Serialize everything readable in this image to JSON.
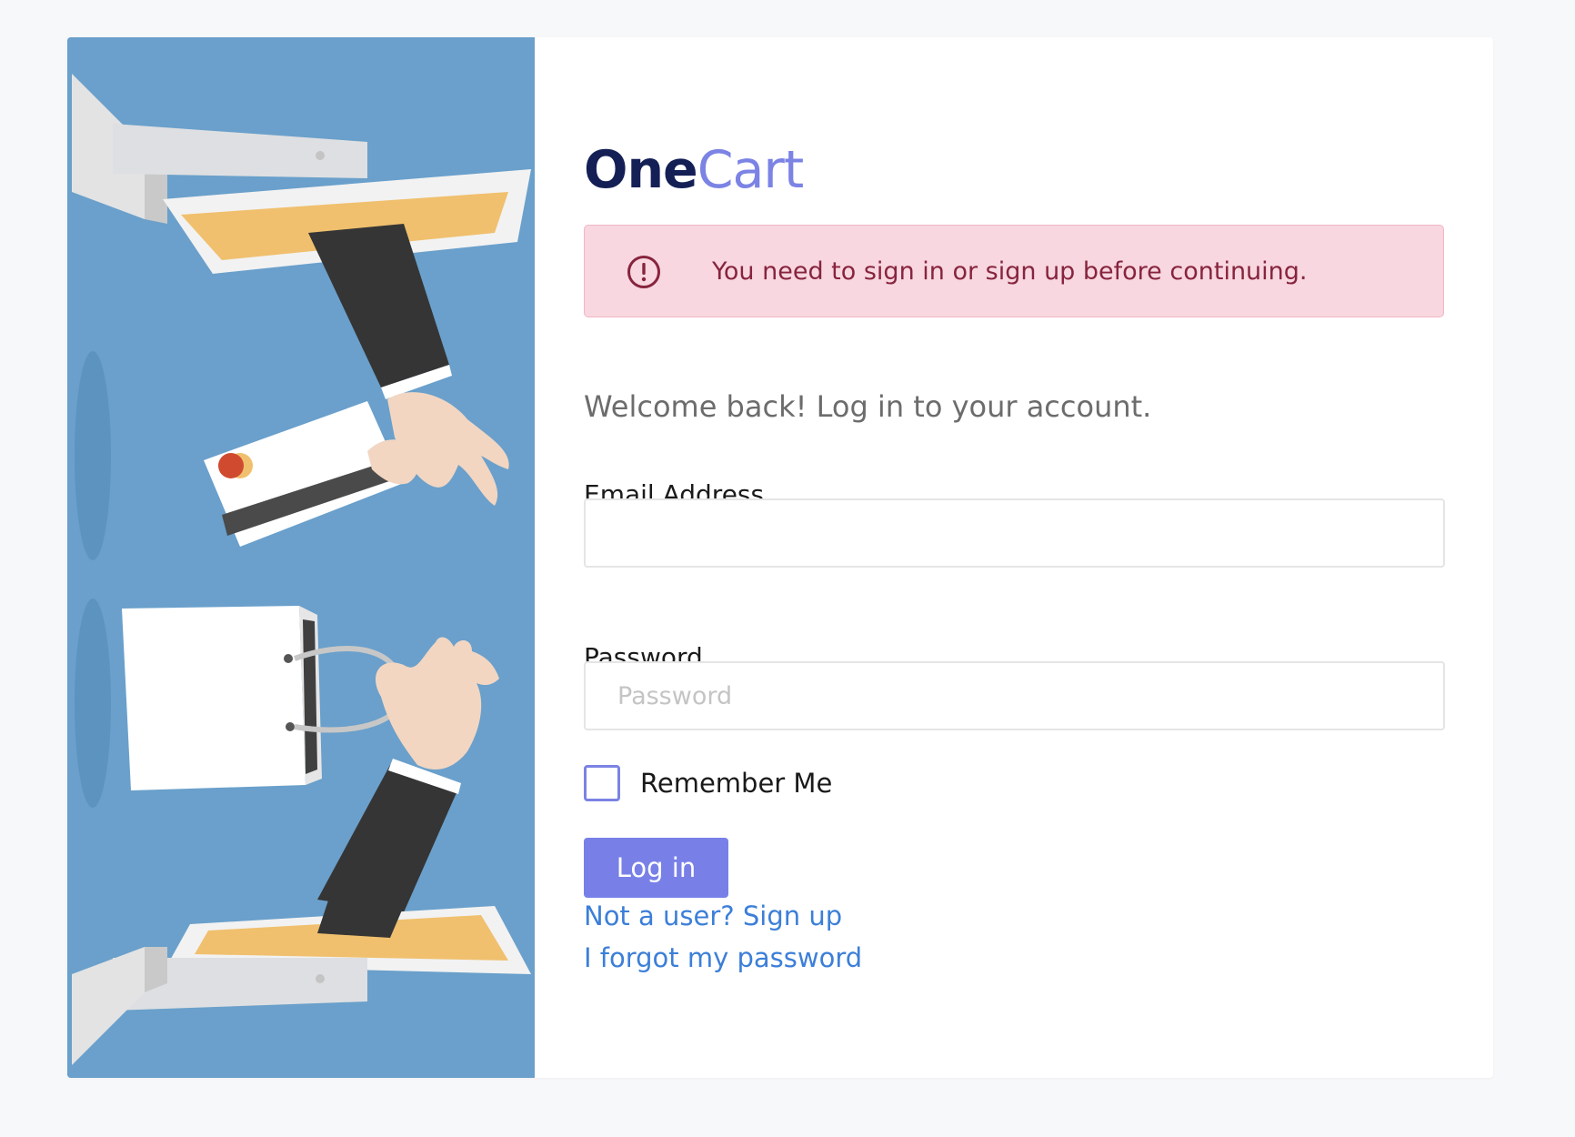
{
  "brand": {
    "part1": "One",
    "part2": "Cart"
  },
  "alert": {
    "icon": "exclamation-circle-icon",
    "message": "You need to sign in or sign up before continuing."
  },
  "welcome": "Welcome back! Log in to your account.",
  "form": {
    "email_label": "Email Address",
    "email_value": "",
    "password_label": "Password",
    "password_placeholder": "Password",
    "remember_label": "Remember Me",
    "remember_checked": false,
    "submit_label": "Log in"
  },
  "links": {
    "signup": "Not a user? Sign up",
    "forgot": "I forgot my password"
  },
  "colors": {
    "brand_dark": "#142055",
    "brand_accent": "#7b83e4",
    "button": "#7880e8",
    "link": "#3c7fd8",
    "alert_bg": "#f8d7e0",
    "alert_text": "#87243e",
    "hero_bg": "#6aa0cb"
  }
}
